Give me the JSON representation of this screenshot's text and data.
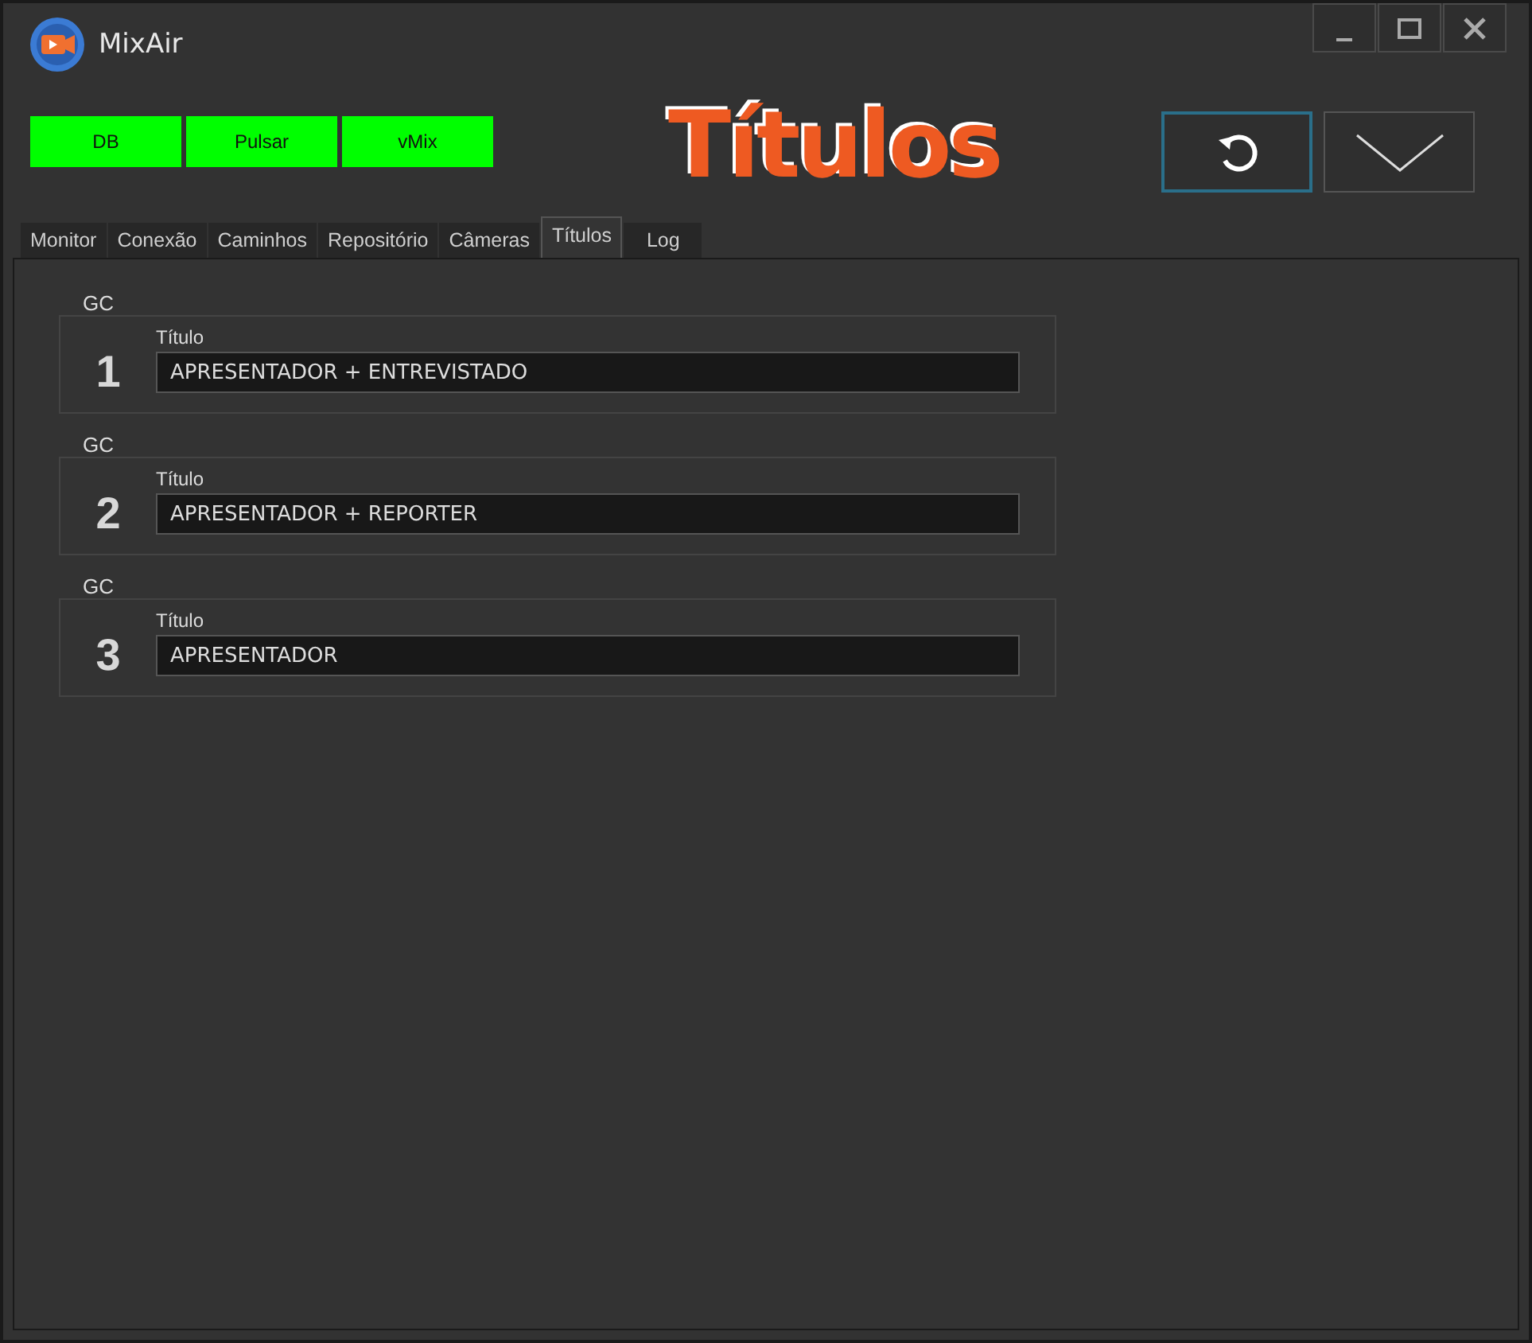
{
  "window": {
    "title": "MixAir"
  },
  "status_indicators": [
    {
      "label": "DB",
      "on": true
    },
    {
      "label": "Pulsar",
      "on": true
    },
    {
      "label": "vMix",
      "on": true
    }
  ],
  "heading": "Títulos",
  "tabs": [
    {
      "label": "Monitor",
      "selected": false
    },
    {
      "label": "Conexão",
      "selected": false
    },
    {
      "label": "Caminhos",
      "selected": false
    },
    {
      "label": "Repositório",
      "selected": false
    },
    {
      "label": "Câmeras",
      "selected": false
    },
    {
      "label": "Títulos",
      "selected": true
    },
    {
      "label": "Log",
      "selected": false
    }
  ],
  "groups": [
    {
      "legend": "GC",
      "number": "1",
      "field_label": "Título",
      "value": "APRESENTADOR + ENTREVISTADO"
    },
    {
      "legend": "GC",
      "number": "2",
      "field_label": "Título",
      "value": "APRESENTADOR + REPORTER"
    },
    {
      "legend": "GC",
      "number": "3",
      "field_label": "Título",
      "value": "APRESENTADOR"
    }
  ]
}
